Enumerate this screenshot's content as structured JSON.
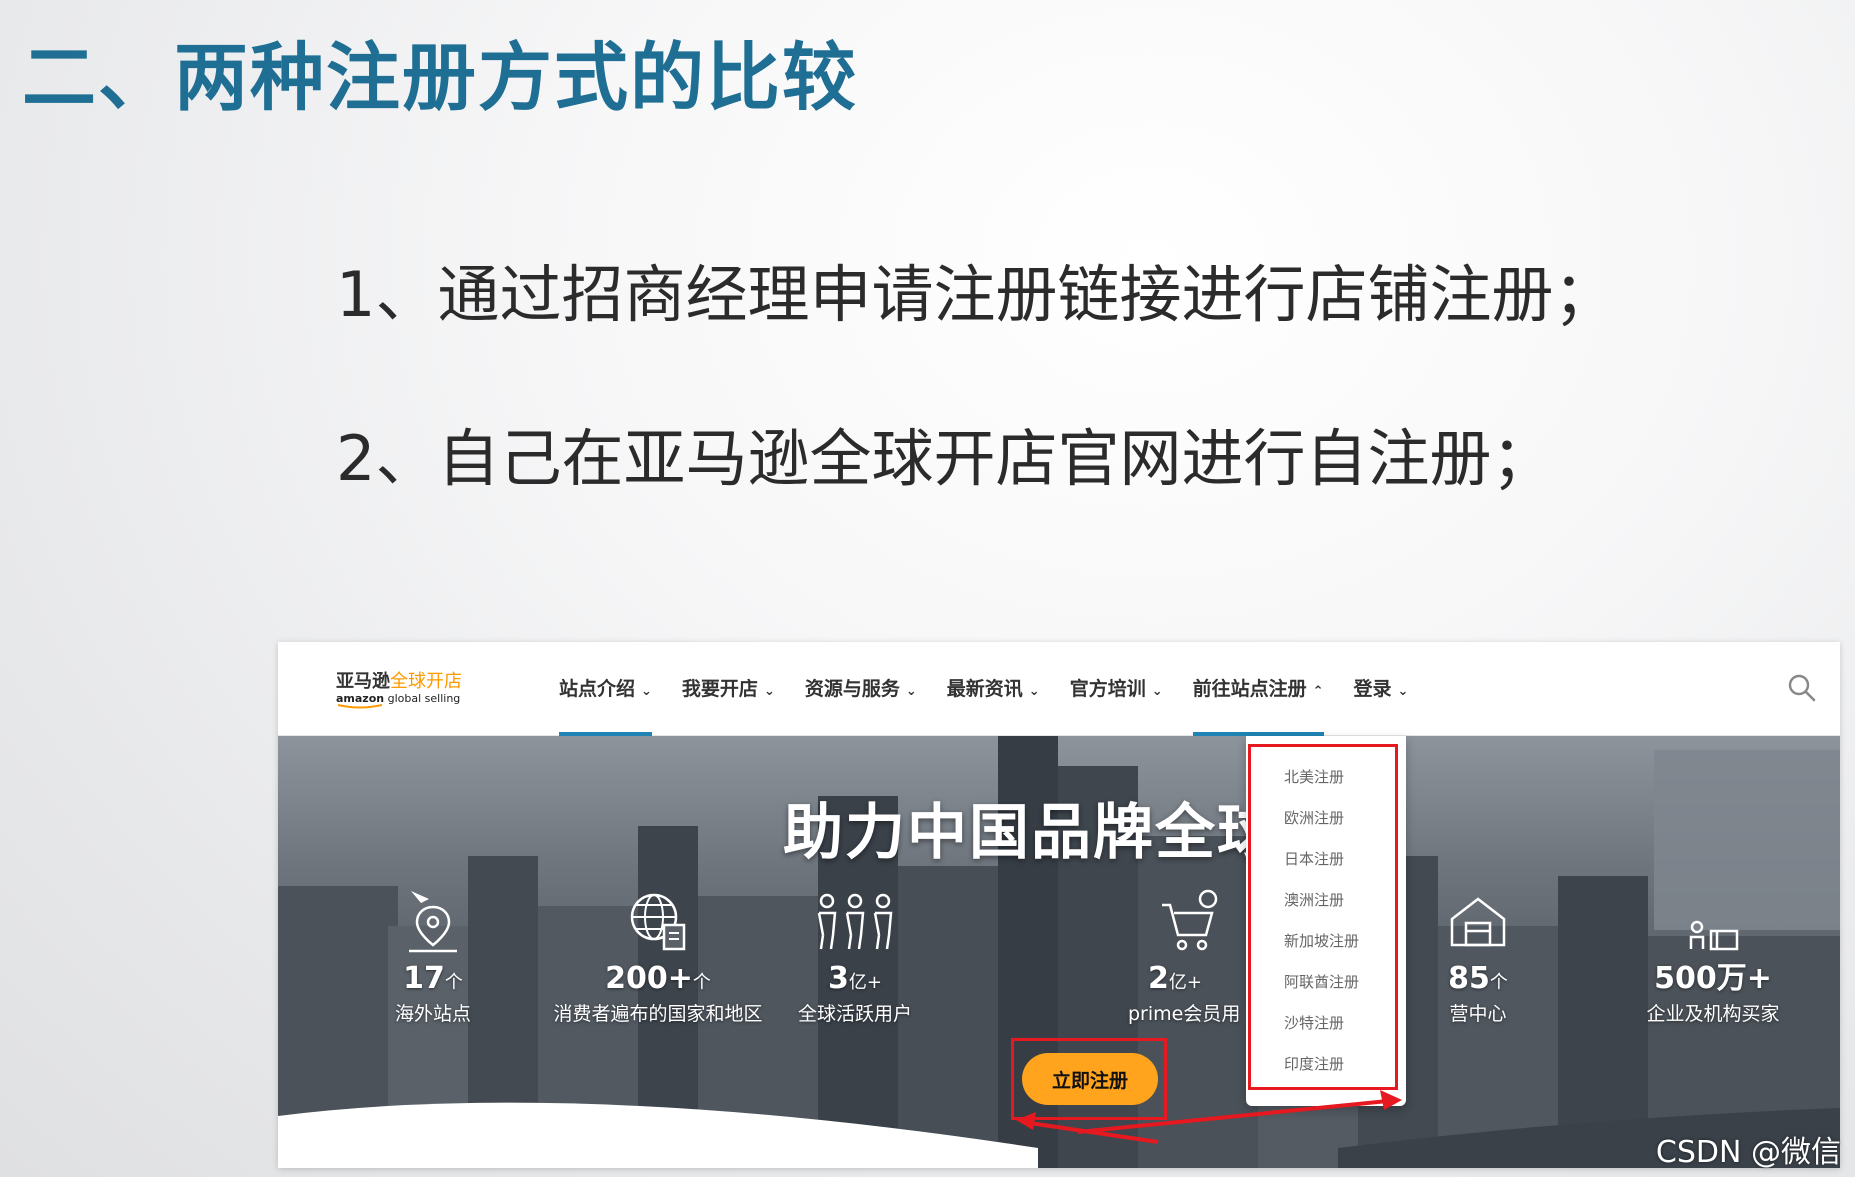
{
  "slide": {
    "title": "二、两种注册方式的比较",
    "bullets": [
      "1、通过招商经理申请注册链接进行店铺注册；",
      "2、自己在亚马逊全球开店官网进行自注册；"
    ]
  },
  "site": {
    "logo": {
      "cn_prefix": "亚马逊",
      "cn_highlight": "全球开店",
      "en_brand": "amazon",
      "en_suffix": " global selling"
    },
    "nav": [
      {
        "label": "站点介绍",
        "chevron": "⌄"
      },
      {
        "label": "我要开店",
        "chevron": "⌄"
      },
      {
        "label": "资源与服务",
        "chevron": "⌄"
      },
      {
        "label": "最新资讯",
        "chevron": "⌄"
      },
      {
        "label": "官方培训",
        "chevron": "⌄"
      },
      {
        "label": "前往站点注册",
        "chevron": "⌃"
      },
      {
        "label": "登录",
        "chevron": "⌄"
      }
    ],
    "search_icon": "search-icon",
    "hero": {
      "title": "助力中国品牌全球",
      "stats": [
        {
          "icon": "plane-pin-icon",
          "value": "17",
          "unit": "个",
          "label": "海外站点"
        },
        {
          "icon": "globe-icon",
          "value": "200+",
          "unit": "个",
          "label": "消费者遍布的国家和地区"
        },
        {
          "icon": "people-icon",
          "value": "3",
          "unit": "亿+",
          "label": "全球活跃用户"
        },
        {
          "icon": "cart-icon",
          "value": "2",
          "unit": "亿+",
          "label": "prime会员用"
        },
        {
          "icon": "warehouse-icon",
          "value": "85",
          "unit": "个",
          "label": "营中心"
        },
        {
          "icon": "buyers-icon",
          "value": "500万+",
          "unit": "",
          "label": "企业及机构买家"
        }
      ],
      "cta": "立即注册"
    },
    "dropdown": [
      "北美注册",
      "欧洲注册",
      "日本注册",
      "澳洲注册",
      "新加坡注册",
      "阿联酋注册",
      "沙特注册",
      "印度注册"
    ]
  },
  "watermark": "CSDN @微信",
  "colors": {
    "title": "#1f6e94",
    "accent_orange": "#ff9900",
    "cta": "#ffa41c",
    "highlight_red": "#e5191f",
    "nav_underline": "#1f84b4"
  }
}
